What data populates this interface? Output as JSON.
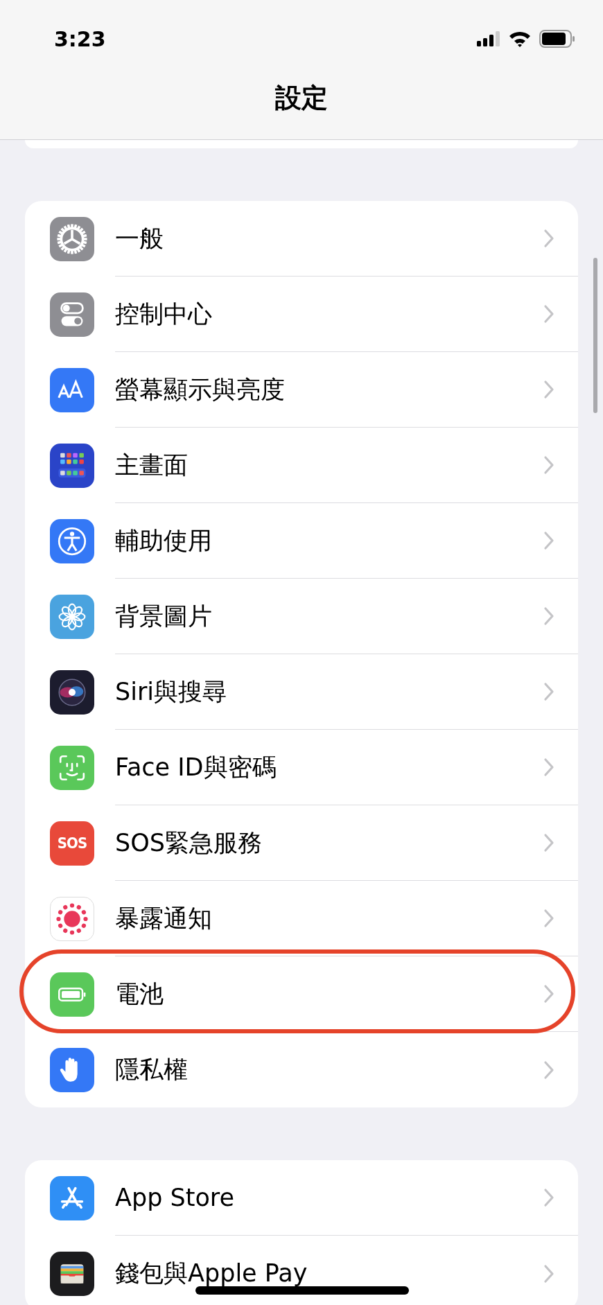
{
  "status_bar": {
    "time": "3:23"
  },
  "nav": {
    "title": "設定"
  },
  "groups": [
    {
      "items": [
        {
          "kind": "general",
          "label": "一般",
          "highlighted": false
        },
        {
          "kind": "control",
          "label": "控制中心",
          "highlighted": false
        },
        {
          "kind": "display",
          "label": "螢幕顯示與亮度",
          "highlighted": false
        },
        {
          "kind": "home",
          "label": "主畫面",
          "highlighted": false
        },
        {
          "kind": "accessibility",
          "label": "輔助使用",
          "highlighted": false
        },
        {
          "kind": "wallpaper",
          "label": "背景圖片",
          "highlighted": false
        },
        {
          "kind": "siri",
          "label": "Siri與搜尋",
          "highlighted": false
        },
        {
          "kind": "faceid",
          "label": "Face ID與密碼",
          "highlighted": false
        },
        {
          "kind": "sos",
          "label": "SOS緊急服務",
          "icon_text": "SOS",
          "highlighted": false
        },
        {
          "kind": "exposure",
          "label": "暴露通知",
          "highlighted": false
        },
        {
          "kind": "battery",
          "label": "電池",
          "highlighted": true
        },
        {
          "kind": "privacy",
          "label": "隱私權",
          "highlighted": false
        }
      ]
    },
    {
      "items": [
        {
          "kind": "appstore",
          "label": "App Store",
          "highlighted": false
        },
        {
          "kind": "wallet",
          "label": "錢包與Apple Pay",
          "highlighted": false
        }
      ]
    }
  ]
}
